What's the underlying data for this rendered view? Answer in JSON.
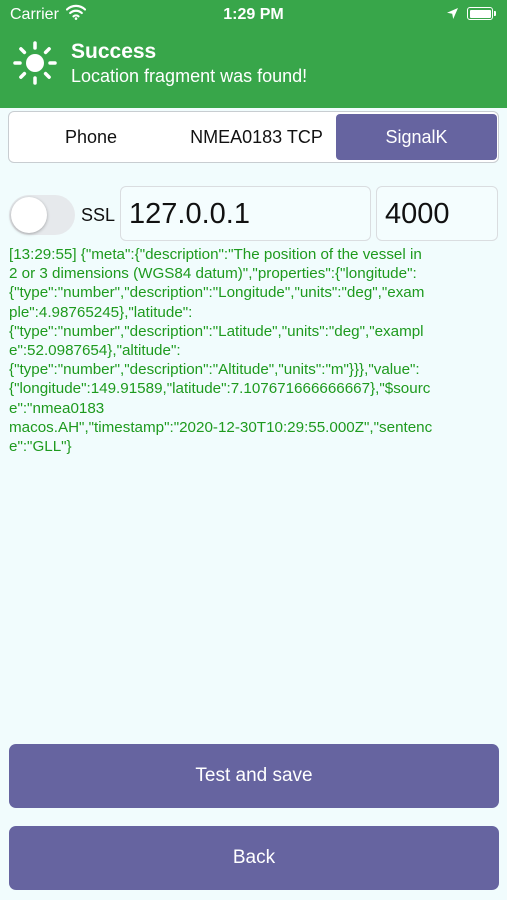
{
  "status_bar": {
    "carrier": "Carrier",
    "time": "1:29 PM"
  },
  "banner": {
    "title": "Success",
    "message": "Location fragment was found!",
    "icon": "sun-icon",
    "color": "#38a64a"
  },
  "tabs": [
    {
      "label": "Phone",
      "selected": false
    },
    {
      "label": "NMEA0183 TCP",
      "selected": false
    },
    {
      "label": "SignalK",
      "selected": true
    }
  ],
  "connection": {
    "ssl_label": "SSL",
    "ssl_enabled": false,
    "host": "127.0.0.1",
    "port": "4000"
  },
  "log": {
    "lines": [
      "[13:29:55] {\"meta\":{\"description\":\"The position of the vessel in",
      "2 or 3 dimensions (WGS84 datum)\",\"properties\":{\"longitude\":",
      "{\"type\":\"number\",\"description\":\"Longitude\",\"units\":\"deg\",\"exam",
      "ple\":4.98765245},\"latitude\":",
      "{\"type\":\"number\",\"description\":\"Latitude\",\"units\":\"deg\",\"exampl",
      "e\":52.0987654},\"altitude\":",
      "{\"type\":\"number\",\"description\":\"Altitude\",\"units\":\"m\"}}},\"value\":",
      "{\"longitude\":149.91589,\"latitude\":7.107671666666667},\"$sourc",
      "e\":\"nmea0183",
      "macos.AH\",\"timestamp\":\"2020-12-30T10:29:55.000Z\",\"sentenc",
      "e\":\"GLL\"}"
    ]
  },
  "buttons": {
    "test_save": "Test and save",
    "back": "Back"
  },
  "colors": {
    "accent": "#6664a0",
    "success": "#38a64a",
    "log_text": "#1e9a1e",
    "background": "#f1fcfd"
  }
}
